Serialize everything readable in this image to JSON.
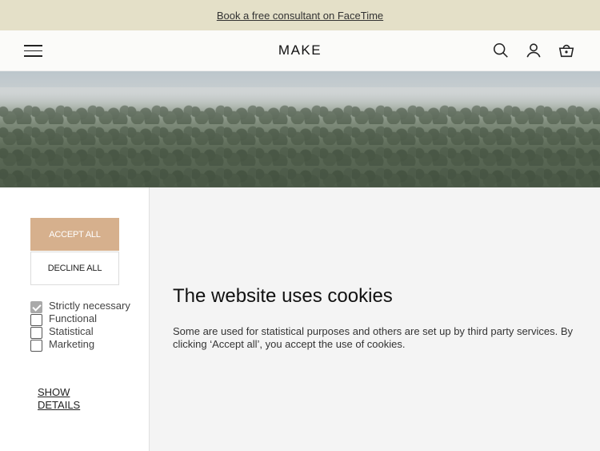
{
  "announcement": {
    "text": "Book a free consultant on FaceTime"
  },
  "header": {
    "logo": "MAKE"
  },
  "cookie_banner": {
    "accept_label": "ACCEPT ALL",
    "decline_label": "DECLINE ALL",
    "options": [
      {
        "label": "Strictly necessary",
        "checked": true
      },
      {
        "label": "Functional",
        "checked": false
      },
      {
        "label": "Statistical",
        "checked": false
      },
      {
        "label": "Marketing",
        "checked": false
      }
    ],
    "show_details_label": "SHOW DETAILS",
    "title": "The website uses cookies",
    "text": "Some are used for statistical purposes and others are set up by third party services. By clicking ‘Accept all’, you accept the use of cookies."
  },
  "colors": {
    "announcement_bg": "#e4e0c8",
    "accent": "#d6b08d"
  }
}
